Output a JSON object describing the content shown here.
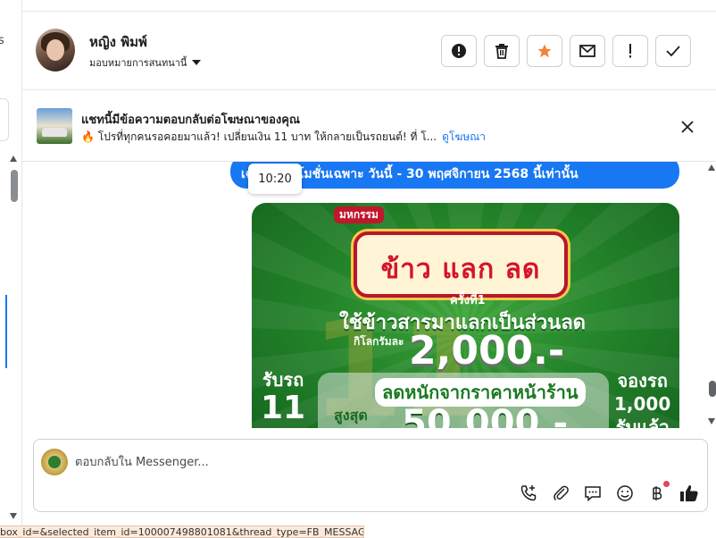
{
  "header": {
    "contact_name": "หญิง พิมพ์",
    "assign_label": "มอบหมายการสนทนานี้"
  },
  "actions": [
    {
      "name": "report-spam",
      "icon": "exclamation-circle-icon"
    },
    {
      "name": "delete",
      "icon": "trash-icon"
    },
    {
      "name": "star",
      "icon": "star-icon",
      "color": "#f5823b"
    },
    {
      "name": "mark-unread",
      "icon": "envelope-icon"
    },
    {
      "name": "follow-up",
      "icon": "exclamation-icon"
    },
    {
      "name": "mark-done",
      "icon": "check-icon"
    }
  ],
  "banner": {
    "title": "แชทนี้มีข้อความตอบกลับต่อโฆษณาของคุณ",
    "subtitle": "🔥 โปรที่ทุกคนรอคอยมาแล้ว! เปลี่ยนเงิน 11 บาท ให้กลายเป็นรถยนต์! ที่ โ...",
    "link": "ดูโฆษณา"
  },
  "chat": {
    "message_text": "เฉพาะโปรโมชั่นเฉพาะ วันนี้ - 30 พฤศจิกายน 2568 นี้เท่านั้น",
    "tooltip_time": "10:20",
    "ad_image": {
      "sign_top": "มหกรรม",
      "sign_main": "ข้าว แลก ลด",
      "sign_sub": "ครั้งที่1",
      "line1": "ใช้ข้าวสารมาแลกเป็นส่วนลด",
      "line2_small": "กิโลกรัมละ",
      "line2_big": "2,000.-",
      "line3": "ลดหนักจากราคาหน้าร้าน",
      "line4_small": "สูงสุด",
      "line4_big": "50,000.-",
      "left_top": "รับรถ",
      "left_big": "11",
      "right_top": "จองรถ",
      "right_num": "1,000",
      "right_bottom": "รับแล้ว"
    }
  },
  "composer": {
    "placeholder": "ตอบกลับใน Messenger..."
  },
  "tools": [
    {
      "name": "call",
      "icon": "phone-plus-icon"
    },
    {
      "name": "attach",
      "icon": "paperclip-icon"
    },
    {
      "name": "saved-replies",
      "icon": "chat-bubble-dots-icon"
    },
    {
      "name": "emoji",
      "icon": "smiley-icon"
    },
    {
      "name": "payment",
      "icon": "baht-icon"
    },
    {
      "name": "like",
      "icon": "thumbs-up-icon"
    }
  ],
  "statusbar": {
    "url": "box_id=&selected_item_id=100007498801081&thread_type=FB_MESSAGE#"
  },
  "left_strip": {
    "cut_text": "s"
  }
}
